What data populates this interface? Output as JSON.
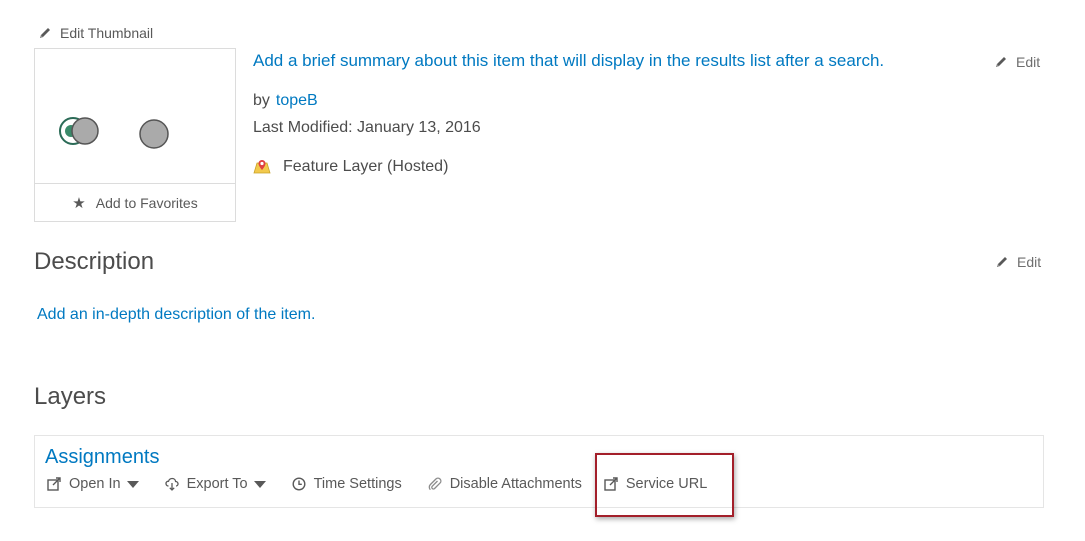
{
  "item": {
    "edit_thumbnail_label": "Edit Thumbnail",
    "add_to_favorites_label": "Add to Favorites",
    "summary_placeholder": "Add a brief summary about this item that will display in the results list after a search.",
    "edit_label": "Edit",
    "owner_prefix": "by",
    "owner": "topeB",
    "last_modified": "Last Modified: January 13, 2016",
    "item_type": "Feature Layer (Hosted)"
  },
  "description": {
    "title": "Description",
    "edit_label": "Edit",
    "placeholder_link": "Add an in-depth description of the item."
  },
  "layers": {
    "title": "Layers",
    "items": [
      {
        "name": "Assignments",
        "actions": {
          "open_in": "Open In",
          "export_to": "Export To",
          "time_settings": "Time Settings",
          "disable_attachments": "Disable Attachments",
          "service_url": "Service URL"
        }
      }
    ]
  },
  "colors": {
    "link": "#0079c1",
    "text": "#4c4c4c",
    "highlight_border": "#a31f2a"
  },
  "icons": [
    "pencil-icon",
    "star-icon",
    "feature-layer-icon",
    "open-in-icon",
    "cloud-download-icon",
    "clock-icon",
    "paperclip-icon",
    "external-link-icon"
  ]
}
